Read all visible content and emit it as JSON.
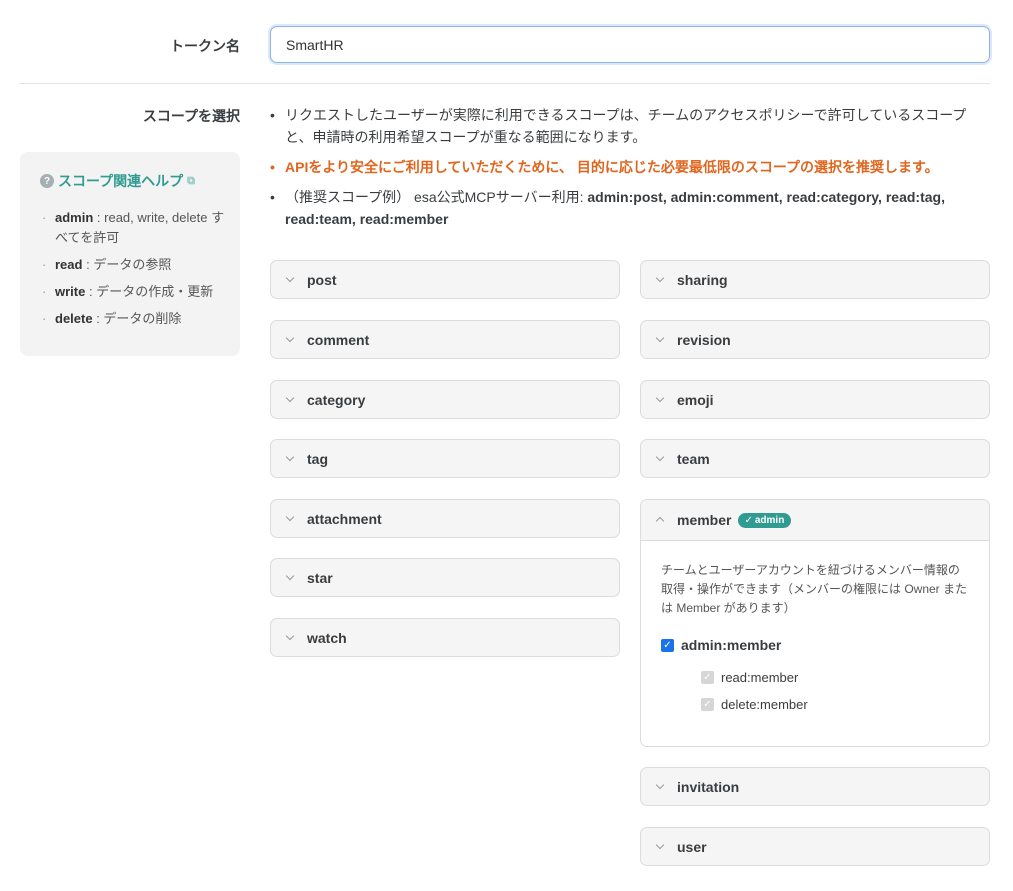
{
  "token": {
    "label": "トークン名",
    "value": "SmartHR"
  },
  "scope": {
    "label": "スコープを選択"
  },
  "help": {
    "title": "スコープ関連ヘルプ",
    "items": [
      {
        "key": "admin",
        "desc": ": read, write, delete すべてを許可"
      },
      {
        "key": "read",
        "desc": ": データの参照"
      },
      {
        "key": "write",
        "desc": ": データの作成・更新"
      },
      {
        "key": "delete",
        "desc": ": データの削除"
      }
    ]
  },
  "notes": {
    "line1": "リクエストしたユーザーが実際に利用できるスコープは、チームのアクセスポリシーで許可しているスコープと、申請時の利用希望スコープが重なる範囲になります。",
    "warning": "APIをより安全にご利用していただくために、 目的に応じた必要最低限のスコープの選択を推奨します。",
    "example_prefix": "（推奨スコープ例） esa公式MCPサーバー利用: ",
    "example_scopes": "admin:post, admin:comment, read:category, read:tag, read:team, read:member"
  },
  "scopes_left": [
    "post",
    "comment",
    "category",
    "tag",
    "attachment",
    "star",
    "watch"
  ],
  "scopes_right_top": [
    "sharing",
    "revision",
    "emoji",
    "team"
  ],
  "member": {
    "name": "member",
    "badge": "admin",
    "description": "チームとユーザーアカウントを紐づけるメンバー情報の取得・操作ができます（メンバーの権限には Owner または Member があります）",
    "main_checkbox": "admin:member",
    "sub_checkboxes": [
      "read:member",
      "delete:member"
    ]
  },
  "scopes_right_bottom": [
    "invitation",
    "user"
  ]
}
